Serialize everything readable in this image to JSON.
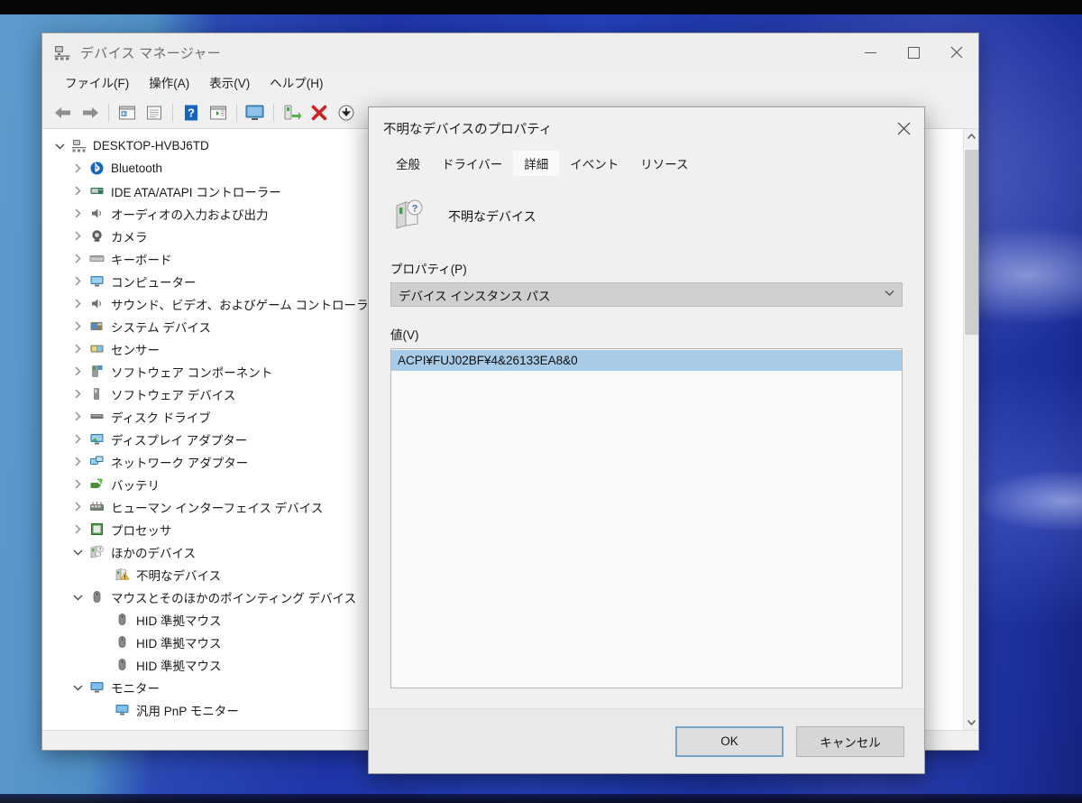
{
  "window": {
    "title": "デバイス マネージャー",
    "title_icon": "device-manager-icon",
    "controls": {
      "minimize": "minimize-icon",
      "maximize": "maximize-icon",
      "close": "close-icon"
    },
    "menu": [
      {
        "label": "ファイル(F)"
      },
      {
        "label": "操作(A)"
      },
      {
        "label": "表示(V)"
      },
      {
        "label": "ヘルプ(H)"
      }
    ],
    "toolbar": [
      {
        "icon": "back-arrow-icon"
      },
      {
        "icon": "forward-arrow-icon"
      },
      {
        "icon": "properties-icon"
      },
      {
        "icon": "scan-list-icon"
      },
      {
        "icon": "help-icon"
      },
      {
        "icon": "show-hidden-devices-icon"
      },
      {
        "icon": "update-driver-icon"
      },
      {
        "icon": "install-legacy-hardware-icon"
      },
      {
        "icon": "uninstall-device-icon"
      },
      {
        "icon": "scan-hardware-changes-icon"
      }
    ]
  },
  "tree": {
    "items": [
      {
        "label": "DESKTOP-HVBJ6TD",
        "level": 0,
        "twisty": "expanded",
        "icon": "computer-root-icon"
      },
      {
        "label": "Bluetooth",
        "level": 1,
        "twisty": "collapsed",
        "icon": "bluetooth-icon"
      },
      {
        "label": "IDE ATA/ATAPI コントローラー",
        "level": 1,
        "twisty": "collapsed",
        "icon": "ide-controller-icon"
      },
      {
        "label": "オーディオの入力および出力",
        "level": 1,
        "twisty": "collapsed",
        "icon": "audio-icon"
      },
      {
        "label": "カメラ",
        "level": 1,
        "twisty": "collapsed",
        "icon": "camera-icon"
      },
      {
        "label": "キーボード",
        "level": 1,
        "twisty": "collapsed",
        "icon": "keyboard-icon"
      },
      {
        "label": "コンピューター",
        "level": 1,
        "twisty": "collapsed",
        "icon": "computer-icon"
      },
      {
        "label": "サウンド、ビデオ、およびゲーム コントローラー",
        "level": 1,
        "twisty": "collapsed",
        "icon": "audio-icon"
      },
      {
        "label": "システム デバイス",
        "level": 1,
        "twisty": "collapsed",
        "icon": "system-devices-icon"
      },
      {
        "label": "センサー",
        "level": 1,
        "twisty": "collapsed",
        "icon": "sensor-icon"
      },
      {
        "label": "ソフトウェア コンポーネント",
        "level": 1,
        "twisty": "collapsed",
        "icon": "software-component-icon"
      },
      {
        "label": "ソフトウェア デバイス",
        "level": 1,
        "twisty": "collapsed",
        "icon": "software-device-icon"
      },
      {
        "label": "ディスク ドライブ",
        "level": 1,
        "twisty": "collapsed",
        "icon": "disk-drive-icon"
      },
      {
        "label": "ディスプレイ アダプター",
        "level": 1,
        "twisty": "collapsed",
        "icon": "display-adapter-icon"
      },
      {
        "label": "ネットワーク アダプター",
        "level": 1,
        "twisty": "collapsed",
        "icon": "network-adapter-icon"
      },
      {
        "label": "バッテリ",
        "level": 1,
        "twisty": "collapsed",
        "icon": "battery-icon"
      },
      {
        "label": "ヒューマン インターフェイス デバイス",
        "level": 1,
        "twisty": "collapsed",
        "icon": "hid-icon"
      },
      {
        "label": "プロセッサ",
        "level": 1,
        "twisty": "collapsed",
        "icon": "processor-icon"
      },
      {
        "label": "ほかのデバイス",
        "level": 1,
        "twisty": "expanded",
        "icon": "other-devices-icon"
      },
      {
        "label": "不明なデバイス",
        "level": 2,
        "twisty": "none",
        "icon": "unknown-device-warning-icon"
      },
      {
        "label": "マウスとそのほかのポインティング デバイス",
        "level": 1,
        "twisty": "expanded",
        "icon": "mouse-icon"
      },
      {
        "label": "HID 準拠マウス",
        "level": 2,
        "twisty": "none",
        "icon": "mouse-icon"
      },
      {
        "label": "HID 準拠マウス",
        "level": 2,
        "twisty": "none",
        "icon": "mouse-icon"
      },
      {
        "label": "HID 準拠マウス",
        "level": 2,
        "twisty": "none",
        "icon": "mouse-icon"
      },
      {
        "label": "モニター",
        "level": 1,
        "twisty": "expanded",
        "icon": "monitor-icon"
      },
      {
        "label": "汎用 PnP モニター",
        "level": 2,
        "twisty": "none",
        "icon": "monitor-icon"
      }
    ]
  },
  "dialog": {
    "title": "不明なデバイスのプロパティ",
    "close_icon": "close-icon",
    "tabs": [
      {
        "label": "全般",
        "active": false
      },
      {
        "label": "ドライバー",
        "active": false
      },
      {
        "label": "詳細",
        "active": true
      },
      {
        "label": "イベント",
        "active": false
      },
      {
        "label": "リソース",
        "active": false
      }
    ],
    "device": {
      "icon": "unknown-device-icon",
      "name": "不明なデバイス"
    },
    "property": {
      "label": "プロパティ(P)",
      "selected": "デバイス インスタンス パス",
      "arrow_icon": "chevron-down-icon"
    },
    "value": {
      "label": "値(V)",
      "rows": [
        {
          "text": "ACPI¥FUJ02BF¥4&26133EA8&0",
          "selected": true
        }
      ]
    },
    "buttons": {
      "ok": "OK",
      "cancel": "キャンセル"
    }
  },
  "colors": {
    "selection_blue": "#a8cbe8",
    "focus_border": "#7aa2c4",
    "window_bg": "#f0f0f0",
    "accent_red": "#cc2222",
    "accent_blue": "#1565c0"
  }
}
